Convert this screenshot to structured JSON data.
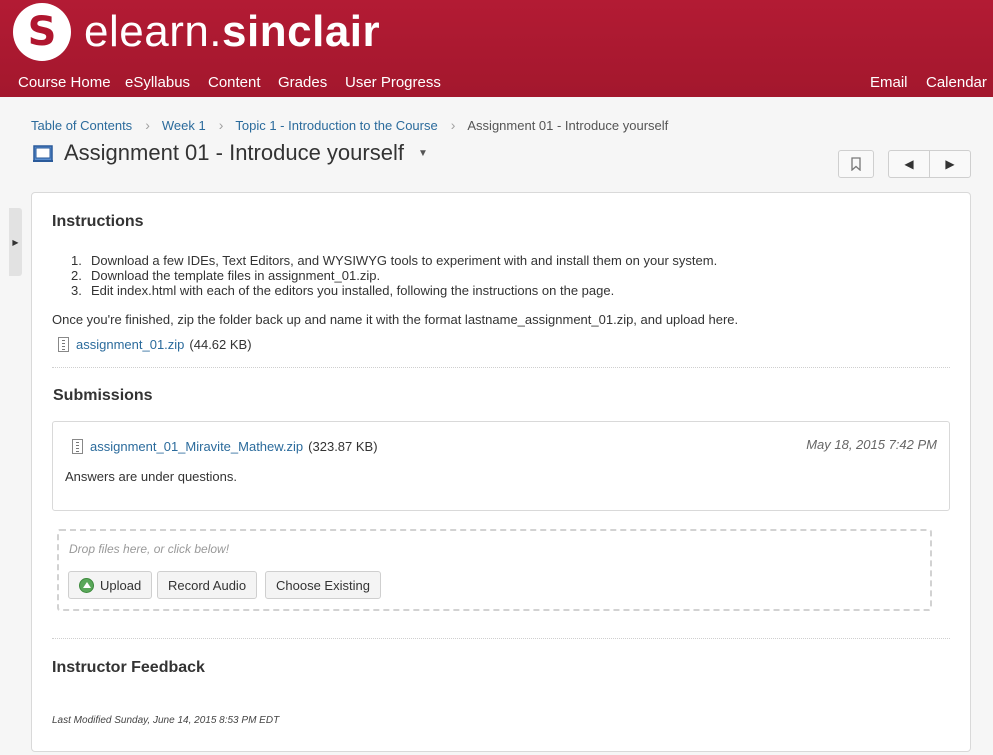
{
  "brand": {
    "logo_glyph": "S",
    "name_light": "elearn.",
    "name_bold": "sinclair",
    "accent_color": "#b31b34"
  },
  "nav": {
    "left": [
      "Course Home",
      "eSyllabus",
      "Content",
      "Grades",
      "User Progress"
    ],
    "right": [
      "Email",
      "Calendar"
    ]
  },
  "breadcrumb": {
    "items": [
      "Table of Contents",
      "Week 1",
      "Topic 1 - Introduction to the Course"
    ],
    "current": "Assignment 01 - Introduce yourself"
  },
  "page": {
    "title": "Assignment 01 - Introduce yourself"
  },
  "instructions": {
    "heading": "Instructions",
    "steps": [
      "Download a few IDEs, Text Editors, and WYSIWYG tools to experiment with and install them on your system.",
      "Download the template files in assignment_01.zip.",
      "Edit index.html with each of the editors you installed, following the instructions on the page."
    ],
    "step_numbers": [
      "1.",
      "2.",
      "3."
    ],
    "note": "Once you're finished, zip the folder back up and name it with the format lastname_assignment_01.zip, and upload here.",
    "attachment": {
      "name": "assignment_01.zip",
      "size": "(44.62 KB)"
    }
  },
  "submissions": {
    "heading": "Submissions",
    "file": {
      "name": "assignment_01_Miravite_Mathew.zip",
      "size": "(323.87 KB)"
    },
    "date": "May 18, 2015 7:42 PM",
    "comment": "Answers are under questions."
  },
  "upload": {
    "hint": "Drop files here, or click below!",
    "upload_label": "Upload",
    "record_label": "Record Audio",
    "existing_label": "Choose Existing"
  },
  "feedback": {
    "heading": "Instructor Feedback",
    "last_modified": "Last Modified Sunday, June 14, 2015 8:53 PM EDT"
  }
}
